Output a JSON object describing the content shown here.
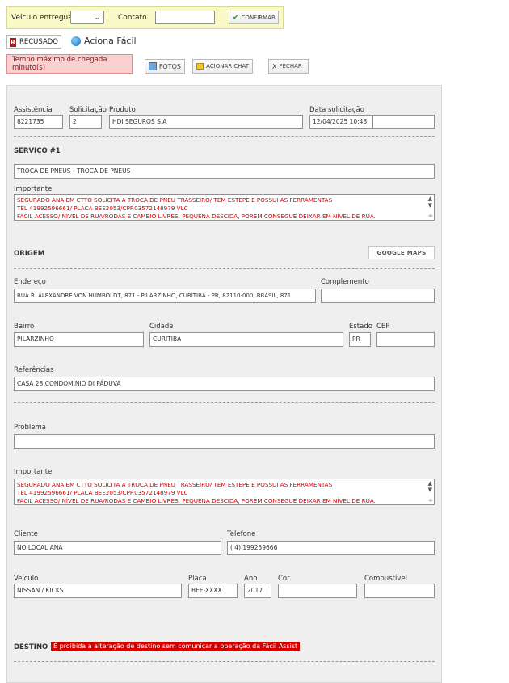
{
  "topbar": {
    "vehicle_delivered_label": "Veículo entregue?",
    "vehicle_delivered_value": "",
    "contact_label": "Contato",
    "contact_value": "",
    "confirm_label": "CONFIRMAR"
  },
  "status": {
    "refused_label": "RECUSADO",
    "aciona_label": "Aciona Fácil",
    "alert_text": "Tempo máximo de chegada minuto(s)"
  },
  "actions": {
    "photos_label": "FOTOS",
    "chat_label": "ACIONAR CHAT",
    "close_label": "FECHAR"
  },
  "request": {
    "assistencia_label": "Assistência",
    "assistencia_value": "8221735",
    "solicitacao_label": "Solicitação",
    "solicitacao_value": "2",
    "produto_label": "Produto",
    "produto_value": "HDI SEGUROS S.A",
    "data_label": "Data solicitação",
    "data_value": "12/04/2025 10:43",
    "data_extra_value": ""
  },
  "service": {
    "title": "SERVIÇO #1",
    "value": "TROCA DE PNEUS - TROCA DE PNEUS",
    "important_label": "Importante",
    "important_lines": [
      "SEGURADO ANA  EM CTTO SOLICITA A TROCA DE PNEU TRASSEIRO/ TEM ESTEPE E POSSUI AS FERRAMENTAS",
      "TEL 41992596661/ PLACA BEE2053/CPF.03572148979 VLC",
      "FACIL ACESSO/ NÍVEL DE RUA/RODAS E CAMBIO LIVRES. PEQUENA DESCIDA, PORÉM CONSEGUE DEIXAR EM NÍVEL DE RUA."
    ]
  },
  "origin": {
    "title": "ORIGEM",
    "google_maps_label": "GOOGLE MAPS",
    "endereco_label": "Endereço",
    "endereco_value": "RUA R. ALEXANDRE VON HUMBOLDT, 871 - PILARZINHO, CURITIBA - PR, 82110-000, BRASIL, 871",
    "complemento_label": "Complemento",
    "complemento_value": "",
    "bairro_label": "Bairro",
    "bairro_value": "PILARZINHO",
    "cidade_label": "Cidade",
    "cidade_value": "CURITIBA",
    "estado_label": "Estado",
    "estado_value": "PR",
    "cep_label": "CEP",
    "cep_value": "",
    "referencias_label": "Referências",
    "referencias_value": "CASA 28 CONDOMÍNIO DI PÁDUVA"
  },
  "problem": {
    "problema_label": "Problema",
    "problema_value": "",
    "important_label": "Importante",
    "important_lines": [
      "SEGURADO ANA  EM CTTO SOLICITA A TROCA DE PNEU TRASSEIRO/ TEM ESTEPE E POSSUI AS FERRAMENTAS",
      "TEL 41992596661/ PLACA BEE2053/CPF.03572148979 VLC",
      "FACIL ACESSO/ NÍVEL DE RUA/RODAS E CAMBIO LIVRES. PEQUENA DESCIDA, PORÉM CONSEGUE DEIXAR EM NÍVEL DE RUA."
    ]
  },
  "client": {
    "cliente_label": "Cliente",
    "cliente_value": "NO LOCAL ANA",
    "telefone_label": "Telefone",
    "telefone_value": "( 4) 199259666"
  },
  "vehicle": {
    "veiculo_label": "Veículo",
    "veiculo_value": "NISSAN / KICKS",
    "placa_label": "Placa",
    "placa_value": "BEE-XXXX",
    "ano_label": "Ano",
    "ano_value": "2017",
    "cor_label": "Cor",
    "cor_value": "",
    "combustivel_label": "Combustível",
    "combustivel_value": ""
  },
  "destination": {
    "title": "DESTINO",
    "warning": "É proibida a alteração de destino sem comunicar a operação da Fácil Assist"
  },
  "colors": {
    "topbar_bg": "#fafac8",
    "alert_bg": "#fbd0d0",
    "important_text": "#d40000",
    "refused_red": "#c0121c",
    "panel_bg": "#efefef"
  }
}
